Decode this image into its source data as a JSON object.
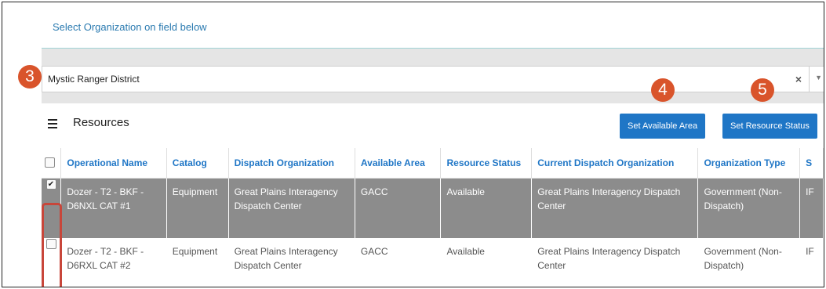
{
  "hint": "Select Organization on field below",
  "org_select": {
    "value": "Mystic Ranger District",
    "clear": "×",
    "caret": "▼"
  },
  "callouts": {
    "c3": "3",
    "c4": "4",
    "c5": "5"
  },
  "panel": {
    "title": "Resources",
    "buttons": {
      "set_available_area": "Set Available Area",
      "set_resource_status": "Set Resource Status"
    }
  },
  "table": {
    "columns": [
      "Operational Name",
      "Catalog",
      "Dispatch Organization",
      "Available Area",
      "Resource Status",
      "Current Dispatch Organization",
      "Organization Type",
      "S"
    ],
    "rows": [
      {
        "checked": true,
        "cells": [
          "Dozer - T2 - BKF - D6NXL CAT #1",
          "Equipment",
          "Great Plains Interagency Dispatch Center",
          "GACC",
          "Available",
          "Great Plains Interagency Dispatch Center",
          "Government (Non-Dispatch)",
          "IF"
        ]
      },
      {
        "checked": false,
        "cells": [
          "Dozer - T2 - BKF - D6RXL CAT #2",
          "Equipment",
          "Great Plains Interagency Dispatch Center",
          "GACC",
          "Available",
          "Great Plains Interagency Dispatch Center",
          "Government (Non-Dispatch)",
          "IF"
        ]
      }
    ]
  },
  "colors": {
    "accent": "#1f76c6",
    "callout": "#d9542b",
    "selected_row": "#8c8c8c",
    "highlight": "#c8463a"
  }
}
